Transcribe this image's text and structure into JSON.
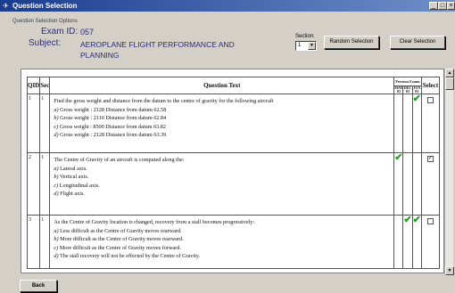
{
  "window": {
    "title": "Question Selection",
    "controls": {
      "minimize": "_",
      "maximize": "□",
      "close": "×"
    }
  },
  "options": {
    "caption": "Question Selection Options",
    "exam_label": "Exam ID:",
    "exam_id": "057",
    "subject_label": "Subject:",
    "subject": "AEROPLANE FLIGHT PERFORMANCE AND PLANNING",
    "section_label": "Section:",
    "section_value": "1",
    "random_button": "Random Selection",
    "clear_button": "Clear Selection"
  },
  "table": {
    "headers": {
      "qid": "QID",
      "sec": "Sec",
      "text": "Question Text",
      "group": "Previous Exams",
      "v1": [
        "MAY",
        "03"
      ],
      "v2": [
        "DEC",
        "03"
      ],
      "v3": [
        "JUN",
        "03"
      ],
      "select": "Select"
    },
    "rows": [
      {
        "qid": "1",
        "sec": "1",
        "question": "Find the gross weight and distance from the datum to the centre of gravity for the following aircraft",
        "options": [
          {
            "letter": "a)",
            "text": "Gross weight : 2128 Distance from datum 62.58"
          },
          {
            "letter": "b)",
            "text": "Gross weight : 2110 Distance from datum 62.84"
          },
          {
            "letter": "c)",
            "text": "Gross weight : 8500 Distance from datum 63.82"
          },
          {
            "letter": "d)",
            "text": "Gross weight : 2128 Distance from datum 63.39"
          }
        ],
        "ticks": [
          false,
          false,
          true
        ],
        "selected": false
      },
      {
        "qid": "2",
        "sec": "1",
        "question": "The Centre of Gravity of an aircraft is computed along the:",
        "options": [
          {
            "letter": "a)",
            "text": "Lateral axis."
          },
          {
            "letter": "b)",
            "text": "Vertical axis."
          },
          {
            "letter": "c)",
            "text": "Longitudinal axis."
          },
          {
            "letter": "d)",
            "text": "Flight axis."
          }
        ],
        "ticks": [
          true,
          false,
          false
        ],
        "selected": true
      },
      {
        "qid": "3",
        "sec": "1",
        "question": "As the Centre of Gravity location is changed, recovery from a stall becomes progressively:",
        "options": [
          {
            "letter": "a)",
            "text": "Less difficult as the Centre of Gravity moves rearward."
          },
          {
            "letter": "b)",
            "text": "More difficult as the Centre of Gravity moves rearward."
          },
          {
            "letter": "c)",
            "text": "More difficult as the Centre of Gravity moves forward."
          },
          {
            "letter": "d)",
            "text": "The stall recovery will not be effected by the Centre of Gravity."
          }
        ],
        "ticks": [
          false,
          true,
          true
        ],
        "selected": false
      }
    ]
  },
  "footer": {
    "back_button": "Back"
  },
  "colors": {
    "titlebar": "#1a3c8f",
    "tick": "#1f9e1f",
    "label": "#2b2b7a"
  },
  "icons": {
    "tick": "checkmark-icon",
    "window": "window-icon"
  }
}
